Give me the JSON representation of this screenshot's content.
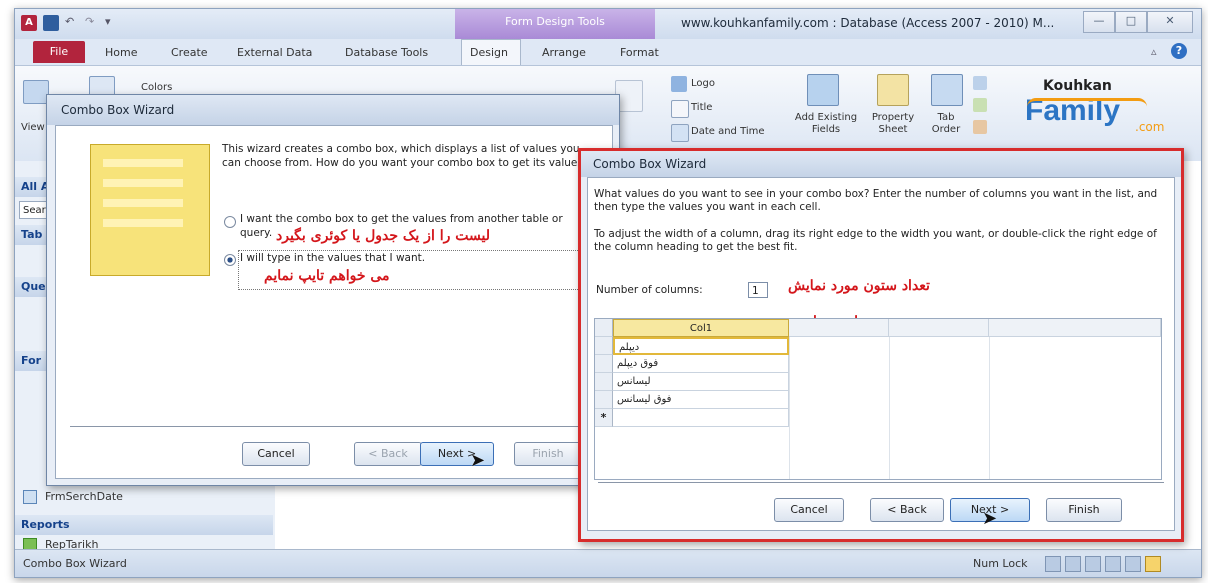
{
  "app": {
    "window_title": "www.kouhkanfamily.com : Database (Access 2007 - 2010) M...",
    "context_tab": "Form Design Tools",
    "minimize": "—",
    "maximize": "□",
    "close": "✕",
    "colors": {
      "accent": "#b2243d",
      "highlight": "#d72c2c",
      "brand_orange": "#f39c12"
    }
  },
  "ribbon_tabs": [
    "Home",
    "Create",
    "External Data",
    "Database Tools",
    "Design",
    "Arrange",
    "Format"
  ],
  "file_tab": "File",
  "ribbon": {
    "view_label": "View",
    "colors_label": "Colors",
    "logo_label": "Logo",
    "title_label": "Title",
    "date_time_label": "Date and Time",
    "add_fields_label": "Add Existing Fields",
    "property_sheet_label": "Property Sheet",
    "tab_order_label": "Tab Order",
    "brand_top": "Kouhkan",
    "brand_main": "Family",
    "brand_suffix": ".com"
  },
  "nav": {
    "all_label": "All A",
    "search_label": "Searc",
    "tables_label": "Tab",
    "queries_label": "Que",
    "forms_label": "For",
    "form_item": "FrmSerchDate",
    "reports_label": "Reports",
    "report_item": "RepTarikh"
  },
  "status": {
    "left": "Combo Box Wizard",
    "num_lock": "Num Lock"
  },
  "wizard1": {
    "title": "Combo Box Wizard",
    "intro": "This wizard creates a combo box, which displays a list of values you can choose from.  How do you want your combo box to get its values?",
    "option1": "I want the combo box to get the values from another table or query.",
    "option1_note": "لیست را از یک جدول یا کوئری بگیرد",
    "option2": "I will type in the values that I want.",
    "option2_note": "می خواهم تایپ نمایم",
    "cancel": "Cancel",
    "back": "< Back",
    "next": "Next >",
    "finish": "Finish"
  },
  "wizard2": {
    "title": "Combo Box Wizard",
    "text1": "What values do you want to see in your combo box? Enter the number of columns you want in the list, and then type the values you want in each cell.",
    "text2": "To adjust the width of a column, drag its right edge to the width you want, or double-click the right edge of the column heading to get the best fit.",
    "num_columns_label": "Number of columns:",
    "num_columns_value": "1",
    "num_columns_note": "تعداد ستون مورد نمایش",
    "type_items_note": "تایپ موارد",
    "column_header": "Col1",
    "rows": [
      "دیپلم",
      "فوق دیپلم",
      "لیسانس",
      "فوق لیسانس"
    ],
    "new_row_marker": "*",
    "cancel": "Cancel",
    "back": "< Back",
    "next": "Next >",
    "finish": "Finish"
  }
}
